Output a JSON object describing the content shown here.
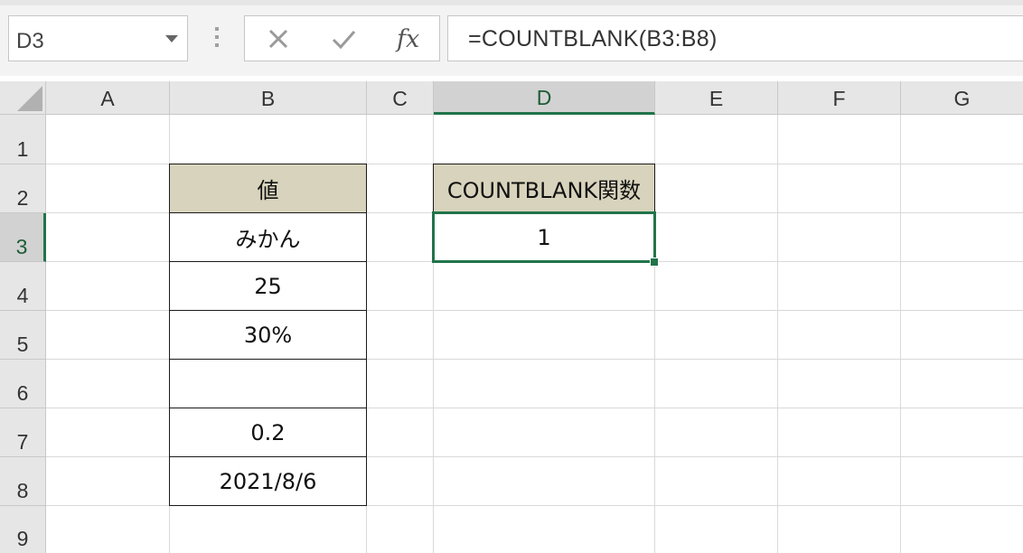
{
  "name_box": {
    "value": "D3"
  },
  "formula_bar": {
    "icons": [
      "cancel-icon",
      "enter-icon",
      "insert-function-icon"
    ],
    "fx_label": "fx",
    "formula": "=COUNTBLANK(B3:B8)"
  },
  "columns": [
    "A",
    "B",
    "C",
    "D",
    "E",
    "F",
    "G"
  ],
  "rows": [
    "1",
    "2",
    "3",
    "4",
    "5",
    "6",
    "7",
    "8",
    "9"
  ],
  "selected": {
    "column": "D",
    "row": "3",
    "cell": "D3"
  },
  "colors": {
    "accent_green": "#21744a",
    "header_fill": "#d8d3bc"
  },
  "table_values": {
    "header": "値",
    "items": [
      "みかん",
      "25",
      "30%",
      "",
      "0.2",
      "2021/8/6"
    ]
  },
  "result_table": {
    "header": "COUNTBLANK関数",
    "value": "1"
  }
}
